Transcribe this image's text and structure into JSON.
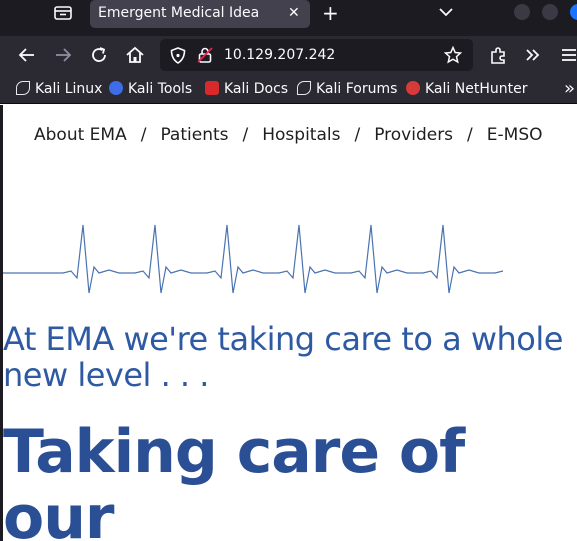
{
  "browser": {
    "tab": {
      "title": "Emergent Medical Idea",
      "close_glyph": "✕"
    },
    "new_tab_glyph": "+",
    "url": "10.129.207.242",
    "bookmarks": [
      {
        "label": "Kali Linux",
        "icon": "kali-dragon-icon",
        "color": "#e8e8ee"
      },
      {
        "label": "Kali Tools",
        "icon": "kali-tools-icon",
        "color": "#3d6ee8"
      },
      {
        "label": "Kali Docs",
        "icon": "kali-docs-icon",
        "color": "#d82a2a"
      },
      {
        "label": "Kali Forums",
        "icon": "kali-dragon-icon",
        "color": "#e8e8ee"
      },
      {
        "label": "Kali NetHunter",
        "icon": "nethunter-icon",
        "color": "#d83a3a"
      }
    ],
    "overflow_glyph": "»"
  },
  "site": {
    "nav": [
      "About EMA",
      "Patients",
      "Hospitals",
      "Providers",
      "E-MSO"
    ],
    "separator": "/",
    "tagline": "At EMA we're taking care to a whole new level . . .",
    "headline": "Taking care of our"
  },
  "colors": {
    "accent": "#2e5aa3",
    "headline": "#2a4f94",
    "ecg": "#4a73b0"
  }
}
